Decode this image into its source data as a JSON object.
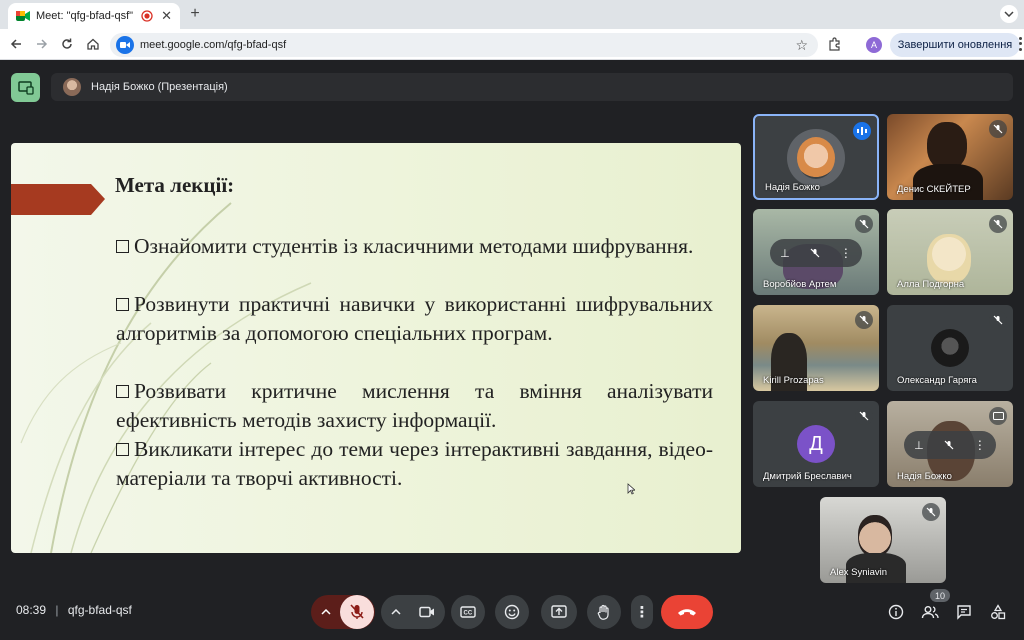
{
  "browser": {
    "tab_title": "Meet: \"qfg-bfad-qsf\"",
    "url": "meet.google.com/qfg-bfad-qsf",
    "update_label": "Завершити оновлення",
    "profile_initial": "A"
  },
  "meeting": {
    "presenter_label": "Надія Божко (Презентація)",
    "time": "08:39",
    "code": "qfg-bfad-qsf",
    "participants_count": "10"
  },
  "slide": {
    "title": "Мета лекції:",
    "bullets": [
      "Ознайомити студентів із класичними методами шифрування.",
      "Розвинути практичні навички у використанні шифрувальних алгоритмів за допомогою спеціальних програм.",
      "Розвивати критичне мислення та вміння аналізувати ефективність методів захисту інформації.",
      "Викликати інтерес до теми через інтерактивні завдання, відео-матеріали та творчі активності."
    ]
  },
  "participants": [
    {
      "name": "Надія Божко"
    },
    {
      "name": "Денис СКЕЙТЕР"
    },
    {
      "name": "Воробйов Артем"
    },
    {
      "name": "Алла Подгорна"
    },
    {
      "name": "Kirill Prozapas"
    },
    {
      "name": "Олександр Гаряга"
    },
    {
      "name": "Дмитрий Бреславич",
      "avatar_letter": "Д"
    },
    {
      "name": "Надія Божко"
    },
    {
      "name": "Alex Syniavin"
    }
  ],
  "colors": {
    "end_call": "#ea4335",
    "mic_off_bg": "#f9dedc",
    "active_border": "#8ab4f8",
    "avatar_purple": "#7b52c8"
  }
}
